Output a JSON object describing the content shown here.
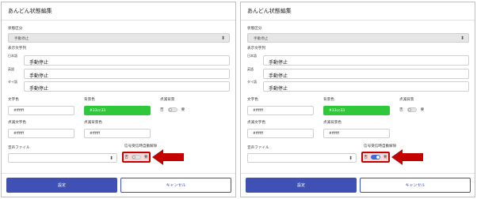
{
  "panels": [
    {
      "title": "あんどん状態編集",
      "status_label": "状態区分",
      "status_value": "手動停止",
      "display_text_label": "表示文字列",
      "rows": [
        {
          "label": "日本語",
          "value": "手動停止"
        },
        {
          "label": "英語",
          "value": "手動停止"
        },
        {
          "label": "タイ語",
          "value": "手動停止"
        }
      ],
      "char_color_label": "文字色",
      "char_color_value": "#ffffff",
      "bg_color_label": "背景色",
      "bg_color_value": "#33cc33",
      "blink_bg_label": "点滅背景",
      "blink_text_label": "点滅文字色",
      "blink_text_value": "#ffffff",
      "blink_bg_color_label": "点滅背景色",
      "blink_bg_color_value": "#ffffff",
      "sound_label": "音声ファイル",
      "signal_label": "信号受信時自動解除",
      "toggle_off": "否",
      "toggle_on": "要",
      "ok_label": "設定",
      "cancel_label": "キャンセル",
      "signal_toggle_state": "off",
      "blink_toggle_state": "off"
    },
    {
      "title": "あんどん状態編集",
      "status_label": "状態区分",
      "status_value": "手動停止",
      "display_text_label": "表示文字列",
      "rows": [
        {
          "label": "日本語",
          "value": "手動停止"
        },
        {
          "label": "英語",
          "value": "手動停止"
        },
        {
          "label": "タイ語",
          "value": "手動停止"
        }
      ],
      "char_color_label": "文字色",
      "char_color_value": "#ffffff",
      "bg_color_label": "背景色",
      "bg_color_value": "#33cc33",
      "blink_bg_label": "点滅背景",
      "blink_text_label": "点滅文字色",
      "blink_text_value": "#ffffff",
      "blink_bg_color_label": "点滅背景色",
      "blink_bg_color_value": "#ffffff",
      "sound_label": "音声ファイル",
      "signal_label": "信号受信時自動解除",
      "toggle_off": "否",
      "toggle_on": "要",
      "ok_label": "設定",
      "cancel_label": "キャンセル",
      "signal_toggle_state": "on",
      "blink_toggle_state": "off"
    }
  ],
  "colors": {
    "accent": "#3f51b5",
    "bg_swatch": "#33cc33",
    "highlight": "#c40000",
    "toggle_on": "#3b6ed8"
  }
}
